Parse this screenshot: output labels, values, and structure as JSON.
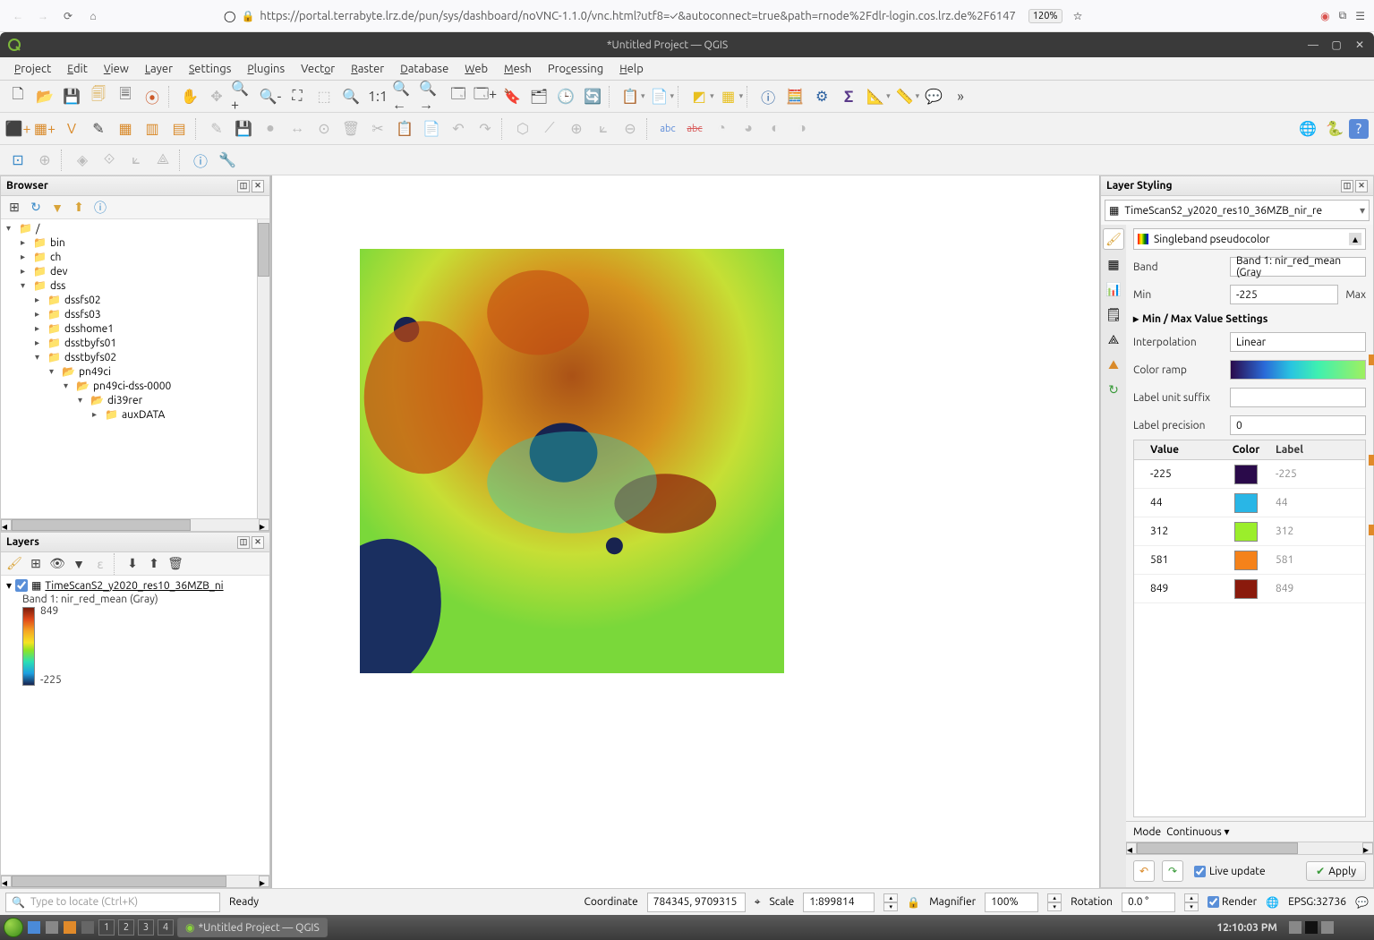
{
  "browser": {
    "url": "https://portal.terrabyte.lrz.de/pun/sys/dashboard/noVNC-1.1.0/vnc.html?utf8=✓&autoconnect=true&path=rnode%2Fdlr-login.cos.lrz.de%2F6147",
    "url_host_bold": "lrz.de",
    "zoom": "120%"
  },
  "qgis": {
    "title": "*Untitled Project — QGIS",
    "menus": [
      "Project",
      "Edit",
      "View",
      "Layer",
      "Settings",
      "Plugins",
      "Vector",
      "Raster",
      "Database",
      "Web",
      "Mesh",
      "Processing",
      "Help"
    ]
  },
  "browser_panel": {
    "title": "Browser",
    "tree": {
      "root": "/",
      "items": [
        {
          "label": "bin",
          "expanded": false
        },
        {
          "label": "ch",
          "expanded": false
        },
        {
          "label": "dev",
          "expanded": false
        },
        {
          "label": "dss",
          "expanded": true,
          "children": [
            {
              "label": "dssfs02",
              "expanded": false
            },
            {
              "label": "dssfs03",
              "expanded": false
            },
            {
              "label": "dsshome1",
              "expanded": false
            },
            {
              "label": "dsstbyfs01",
              "expanded": false
            },
            {
              "label": "dsstbyfs02",
              "expanded": true,
              "children": [
                {
                  "label": "pn49ci",
                  "expanded": true,
                  "open": true,
                  "children": [
                    {
                      "label": "pn49ci-dss-0000",
                      "expanded": true,
                      "open": true,
                      "children": [
                        {
                          "label": "di39rer",
                          "expanded": true,
                          "open": true,
                          "children": [
                            {
                              "label": "auxDATA",
                              "expanded": false
                            }
                          ]
                        }
                      ]
                    }
                  ]
                }
              ]
            }
          ]
        }
      ]
    }
  },
  "layers_panel": {
    "title": "Layers",
    "layer": {
      "checked": true,
      "name": "TimeScanS2_y2020_res10_36MZB_ni",
      "band_label": "Band 1: nir_red_mean (Gray)",
      "legend_max": "849",
      "legend_min": "-225"
    }
  },
  "styling_panel": {
    "title": "Layer Styling",
    "selected_layer": "TimeScanS2_y2020_res10_36MZB_nir_re",
    "renderer": "Singleband pseudocolor",
    "band_label": "Band",
    "band_value": "Band 1: nir_red_mean (Gray",
    "min_label": "Min",
    "min_value": "-225",
    "max_label": "Max",
    "section_minmax": "Min / Max Value Settings",
    "interp_label": "Interpolation",
    "interp_value": "Linear",
    "ramp_label": "Color ramp",
    "suffix_label": "Label unit suffix",
    "suffix_value": "",
    "precision_label": "Label precision",
    "precision_value": "0",
    "cols": {
      "value": "Value",
      "color": "Color",
      "label": "Label"
    },
    "classes": [
      {
        "value": "-225",
        "color": "#2a0a4a",
        "label": "-225"
      },
      {
        "value": "44",
        "color": "#29b6e6",
        "label": "44"
      },
      {
        "value": "312",
        "color": "#9bee2b",
        "label": "312"
      },
      {
        "value": "581",
        "color": "#f5821a",
        "label": "581"
      },
      {
        "value": "849",
        "color": "#8a1a0c",
        "label": "849"
      }
    ],
    "mode_label": "Mode",
    "mode_value": "Continuous",
    "live_update": "Live update",
    "apply": "Apply"
  },
  "status": {
    "locator_placeholder": "Type to locate (Ctrl+K)",
    "ready": "Ready",
    "coord_label": "Coordinate",
    "coord_value": "784345, 9709315",
    "scale_label": "Scale",
    "scale_value": "1:899814",
    "magnifier_label": "Magnifier",
    "magnifier_value": "100%",
    "rotation_label": "Rotation",
    "rotation_value": "0.0 °",
    "render_label": "Render",
    "crs": "EPSG:32736"
  },
  "taskbar": {
    "workspaces": [
      "1",
      "2",
      "3",
      "4"
    ],
    "task": "*Untitled Project — QGIS",
    "clock": "12:10:03 PM"
  }
}
